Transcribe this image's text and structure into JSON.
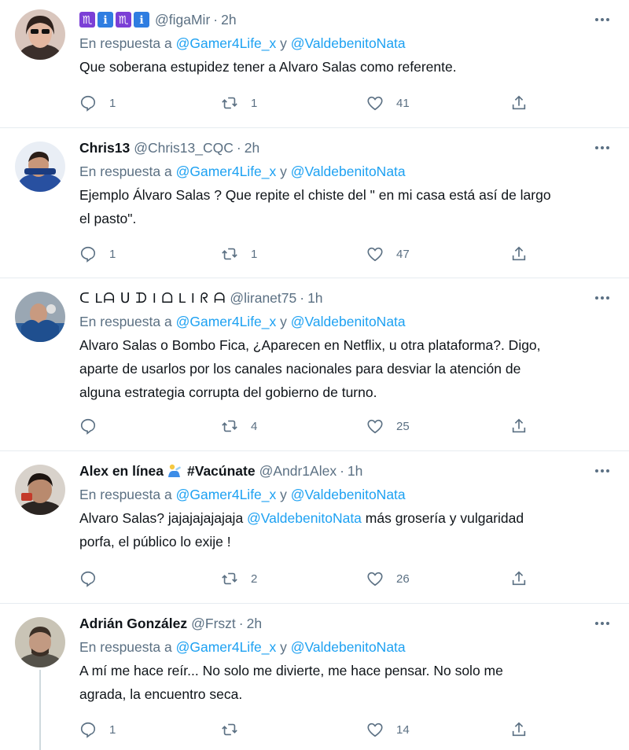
{
  "reply_prefix": "En respuesta a",
  "reply_join": "y",
  "tweets": [
    {
      "name": "",
      "badges": [
        "♏",
        "ℹ",
        "♏",
        "ℹ"
      ],
      "handle": "@figaMir",
      "time": "2h",
      "replying_to": [
        "@Gamer4Life_x",
        "@ValdebenitoNata"
      ],
      "text": "Que soberana estupidez tener a Alvaro Salas como referente.",
      "replies": "1",
      "retweets": "1",
      "likes": "41",
      "avatar_color": "#6b5a55"
    },
    {
      "name": "Chris13",
      "handle": "@Chris13_CQC",
      "time": "2h",
      "replying_to": [
        "@Gamer4Life_x",
        "@ValdebenitoNata"
      ],
      "text_lines": [
        "Ejemplo Álvaro Salas ? Que repite el chiste del \" en mi casa está así de largo",
        "el pasto\"."
      ],
      "replies": "1",
      "retweets": "1",
      "likes": "47",
      "avatar_color": "#2a4a8a"
    },
    {
      "name": "ᑕ Lᗩ ᑌ ᗪ I ᗝ  L I ᖇ ᗩ",
      "handle": "@liranet75",
      "time": "1h",
      "replying_to": [
        "@Gamer4Life_x",
        "@ValdebenitoNata"
      ],
      "text_lines": [
        "Alvaro Salas o Bombo Fica, ¿Aparecen en Netflix, u otra plataforma?. Digo,",
        "aparte de usarlos por los canales nacionales para desviar la atención de",
        "alguna estrategia corrupta del gobierno de turno."
      ],
      "replies": "",
      "retweets": "4",
      "likes": "25",
      "avatar_color": "#2d5f9c"
    },
    {
      "name": "Alex en línea",
      "name_suffix": "#Vacúnate",
      "handle": "@Andr1Alex",
      "time": "1h",
      "replying_to": [
        "@Gamer4Life_x",
        "@ValdebenitoNata"
      ],
      "text_lines_pre": "Alvaro Salas? jajajajajajaja ",
      "text_mention": "@ValdebenitoNata",
      "text_lines_post": " más grosería y vulgaridad",
      "text_line2": "porfa, el público lo exije !",
      "replies": "",
      "retweets": "2",
      "likes": "26",
      "avatar_color": "#3a2a22"
    },
    {
      "name": "Adrián González",
      "handle": "@Frszt",
      "time": "2h",
      "replying_to": [
        "@Gamer4Life_x",
        "@ValdebenitoNata"
      ],
      "text_lines": [
        "A mí me hace reír... No solo me divierte, me hace pensar. No solo me",
        "agrada, la encuentro seca."
      ],
      "replies": "1",
      "retweets": "",
      "likes": "14",
      "avatar_color": "#6f6a60"
    }
  ]
}
